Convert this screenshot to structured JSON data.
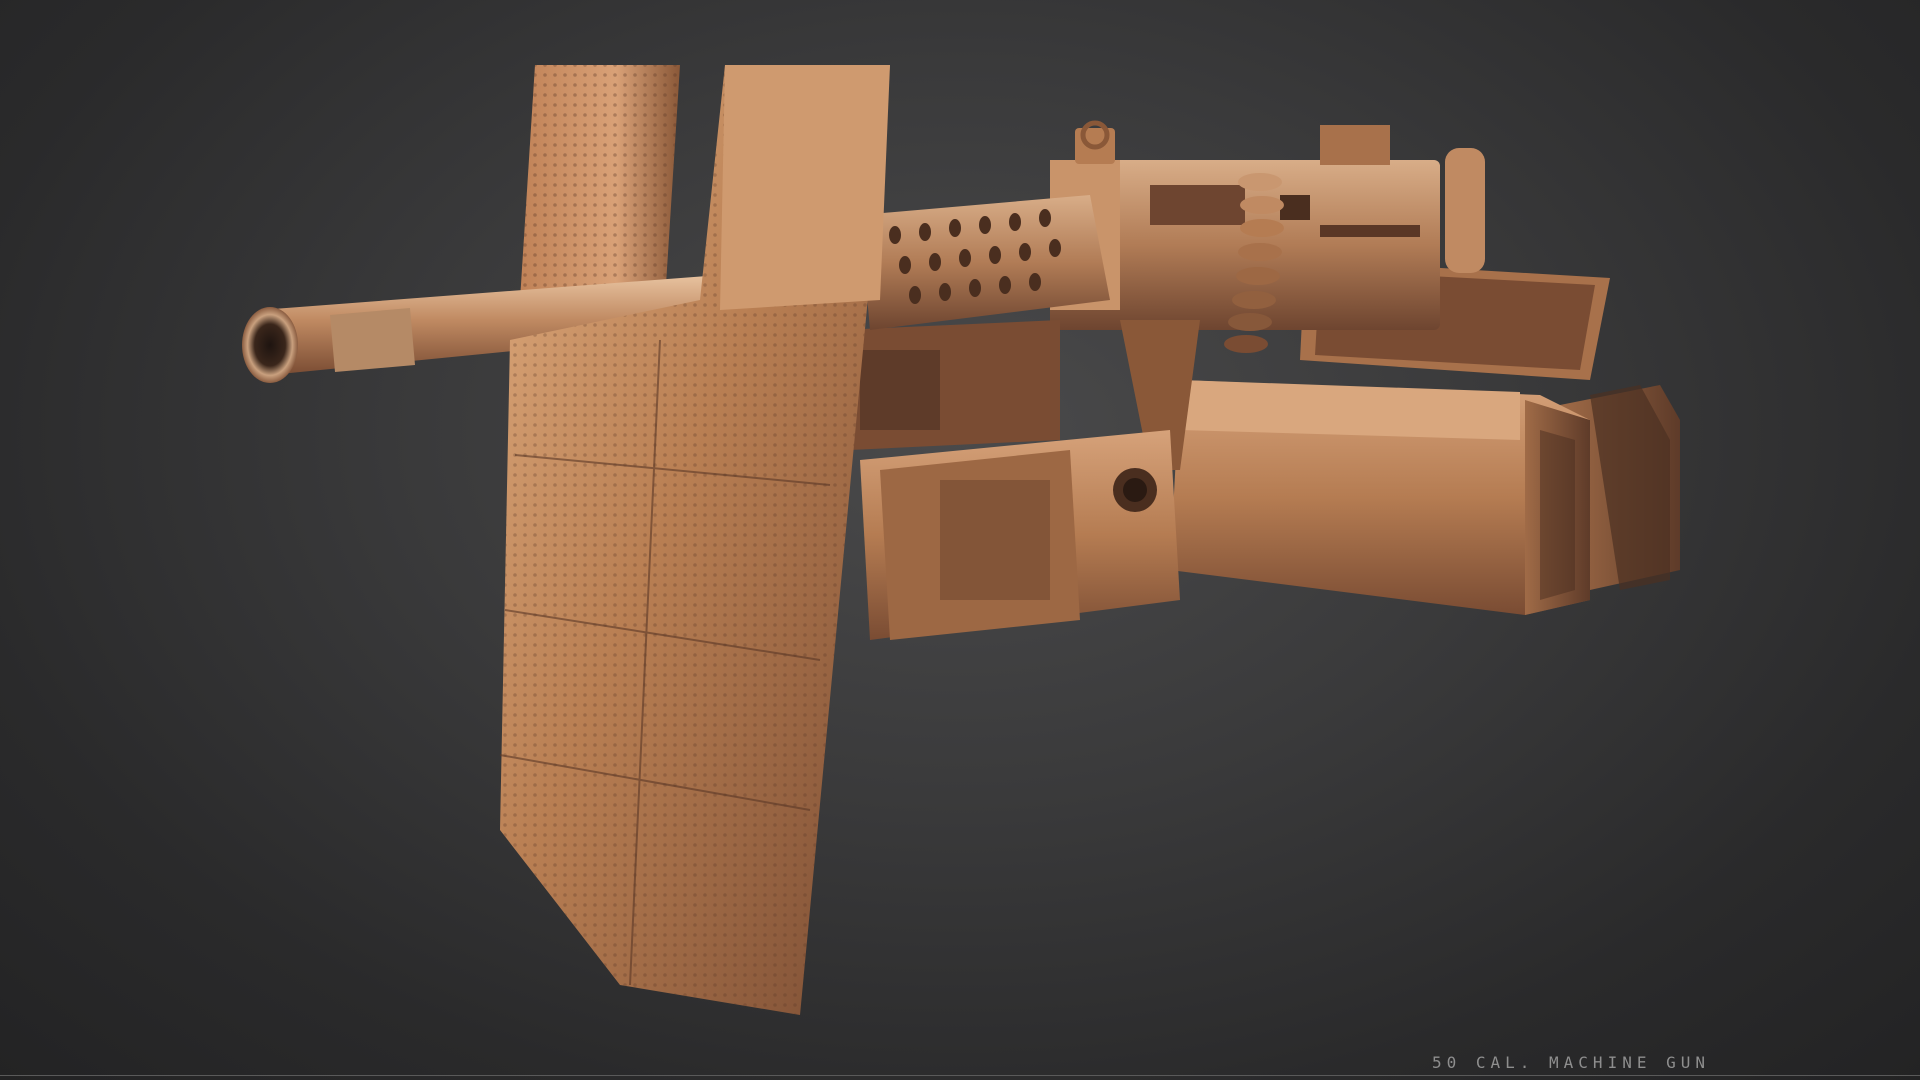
{
  "caption": "50 CAL. MACHINE GUN",
  "palette": {
    "background": "#3a3a3b",
    "copper_light": "#d9a478",
    "copper_mid": "#b57c52",
    "copper_dark": "#6e4530",
    "rivet": "#4a2e1f"
  }
}
